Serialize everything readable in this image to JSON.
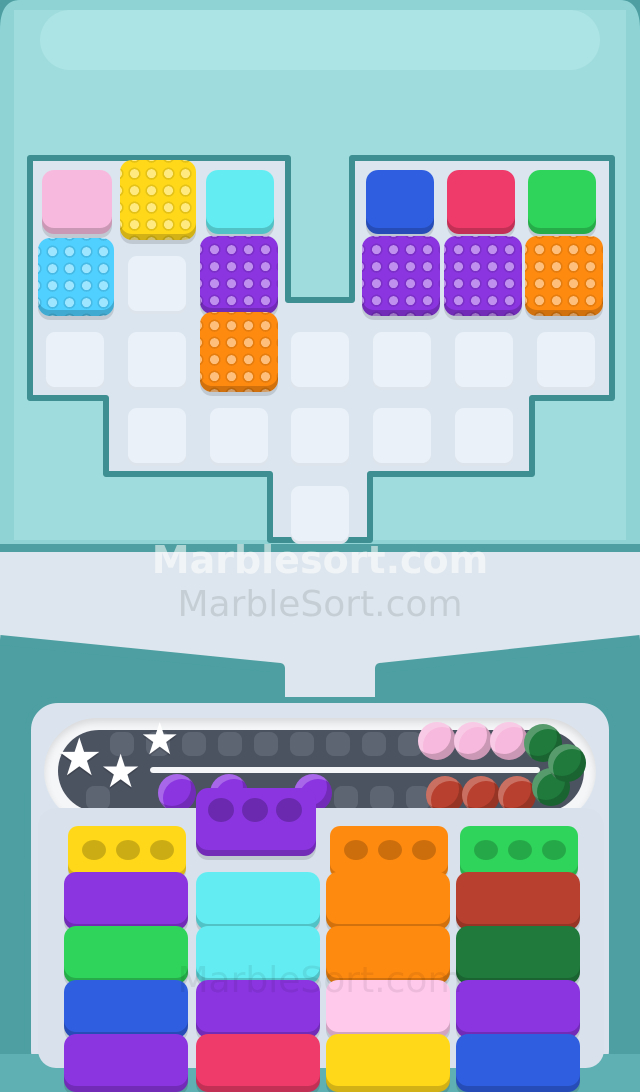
{
  "watermarks": {
    "primary": "Marblesort.com",
    "secondary": "MarbleSort.com",
    "bottom": "MarbleSort.com"
  },
  "colors": {
    "pink": "#f7b9dd",
    "yellow": "#ffd81a",
    "cyan": "#63edf2",
    "light_blue": "#4fd0ff",
    "purple": "#8a35e0",
    "orange": "#ff8a10",
    "blue": "#2f5fe0",
    "red": "#ee3b6a",
    "green": "#2fd45a",
    "dark_red": "#b8402e",
    "dark_green": "#1f7a3c",
    "peach_pink": "#ffc9ec",
    "board": "#9fdedf",
    "board_edge": "#3d8f91"
  },
  "board_blocks": [
    {
      "color": "pink",
      "dotted": false
    },
    {
      "color": "yellow",
      "dotted": true
    },
    {
      "color": "cyan",
      "dotted": false
    },
    {
      "color": "light_blue",
      "dotted": true
    },
    {
      "color": "purple",
      "dotted": true
    },
    {
      "color": "orange",
      "dotted": true
    },
    {
      "color": "blue",
      "dotted": false
    },
    {
      "color": "red",
      "dotted": false
    },
    {
      "color": "green",
      "dotted": false
    },
    {
      "color": "purple",
      "dotted": true
    },
    {
      "color": "purple",
      "dotted": true
    },
    {
      "color": "orange",
      "dotted": true
    }
  ],
  "track": {
    "stars": 3,
    "marbles_top_row": [
      "pink",
      "pink",
      "pink",
      "dark_green"
    ],
    "marbles_bottom_row": [
      "dark_red",
      "dark_red",
      "dark_red",
      "dark_green"
    ],
    "marbles_right": [
      "dark_green"
    ],
    "purple_marbles": 3
  },
  "active_block": {
    "color": "purple",
    "holes": 3
  },
  "columns": [
    {
      "top": "yellow",
      "stack": [
        "purple",
        "green",
        "blue",
        "purple"
      ]
    },
    {
      "top": null,
      "stack": [
        "cyan",
        "cyan",
        "purple",
        "red"
      ]
    },
    {
      "top": "orange",
      "stack": [
        "orange",
        "orange",
        "peach_pink",
        "yellow"
      ]
    },
    {
      "top": "green",
      "stack": [
        "dark_red",
        "dark_green",
        "purple",
        "blue"
      ]
    }
  ]
}
